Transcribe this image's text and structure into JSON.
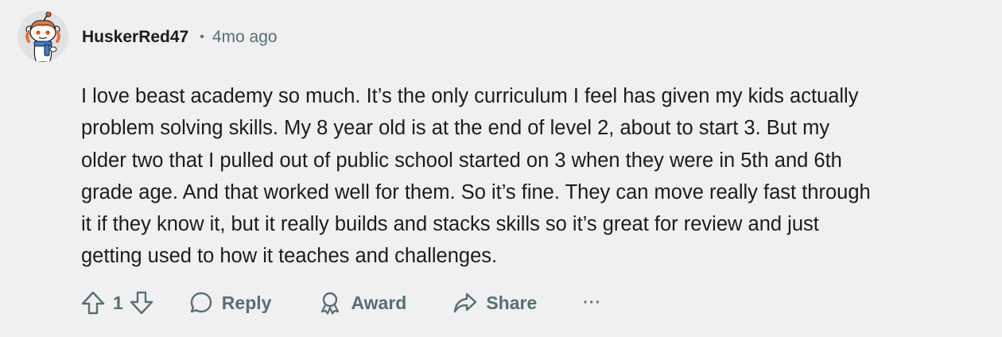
{
  "comment": {
    "author": "HuskerRed47",
    "separator": "•",
    "time_ago": "4mo ago",
    "avatar_icon": "snoo-avatar-icon",
    "body_lines": [
      "I love beast academy so much. It’s the only curriculum I feel has given my kids actually",
      "problem solving skills. My 8 year old is at the end of level 2, about to start 3. But my",
      "older two that I pulled out of public school started on 3 when they were in 5th and 6th",
      "grade age. And that worked well for them. So it’s fine. They can move really fast through",
      "it if they know it, but it really builds and stacks skills so it’s great for review and just",
      "getting used to how it teaches and challenges."
    ]
  },
  "actions": {
    "vote_count": "1",
    "reply_label": "Reply",
    "award_label": "Award",
    "share_label": "Share",
    "more_label": "···"
  },
  "colors": {
    "background": "#f0f0f0",
    "text": "#1c1c1c",
    "muted": "#576f76"
  }
}
